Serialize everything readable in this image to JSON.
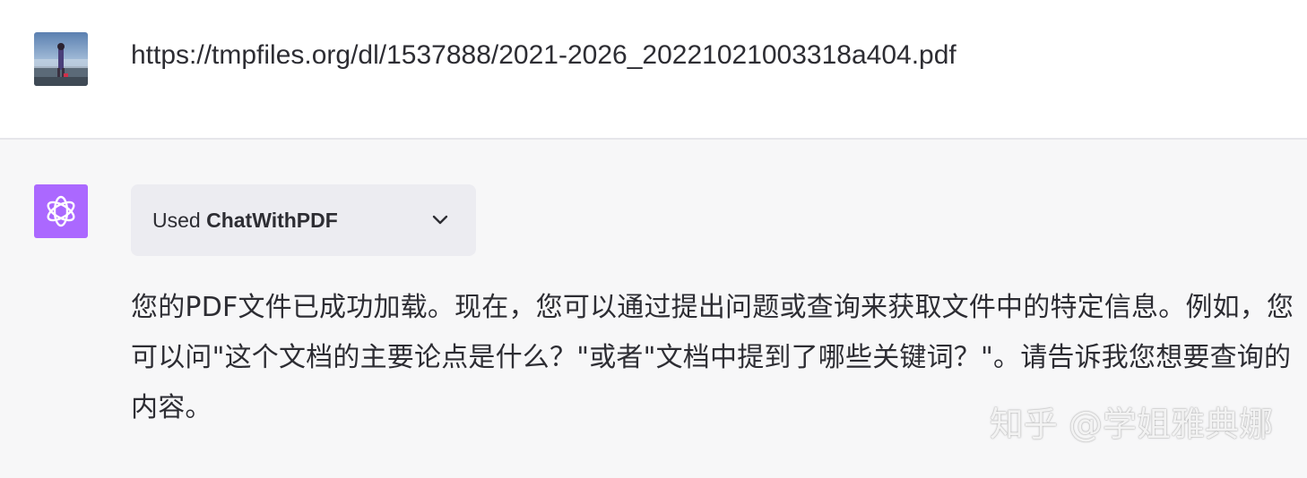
{
  "user_message": {
    "text": "https://tmpfiles.org/dl/1537888/2021-2026_20221021003318a404.pdf",
    "avatar": "user-photo-icon"
  },
  "assistant_message": {
    "avatar": "openai-logo-icon",
    "accent_color": "#ab68ff",
    "plugin": {
      "prefix": "Used",
      "name": "ChatWithPDF",
      "toggle_icon": "chevron-down-icon"
    },
    "paragraph": "您的PDF文件已成功加载。现在，您可以通过提出问题或查询来获取文件中的特定信息。例如，您可以问\"这个文档的主要论点是什么？\"或者\"文档中提到了哪些关键词？\"。请告诉我您想要查询的内容。"
  },
  "watermark": "知乎 @学姐雅典娜"
}
